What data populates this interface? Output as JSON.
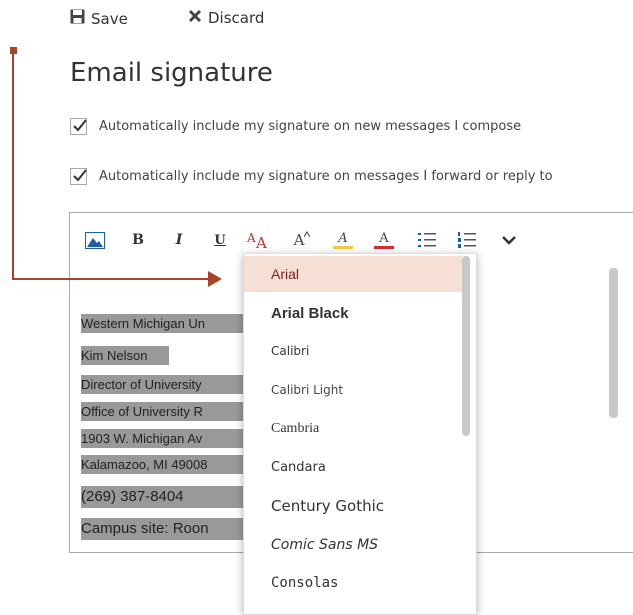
{
  "toolbar": {
    "save_label": "Save",
    "discard_label": "Discard"
  },
  "page_title": "Email signature",
  "options": {
    "new_messages": {
      "label": "Automatically include my signature on new messages I compose",
      "checked": true
    },
    "forward_reply": {
      "label": "Automatically include my signature on messages I forward or reply to",
      "checked": true
    }
  },
  "format_toolbar": {
    "bold": "B",
    "italic": "I",
    "underline": "U",
    "font_size": "A",
    "text_highlight": "A",
    "font_color": "A"
  },
  "signature": {
    "lines": [
      "Western Michigan Un",
      "Kim Nelson",
      "Director of University",
      "Office of University R",
      "1903 W. Michigan Av",
      "Kalamazoo, MI 49008",
      "(269) 387-8404",
      "Campus site: Roon"
    ]
  },
  "font_menu": {
    "selected": "Arial",
    "items": [
      "Arial",
      "Arial Black",
      "Calibri",
      "Calibri Light",
      "Cambria",
      "Candara",
      "Century Gothic",
      "Comic Sans MS",
      "Consolas"
    ]
  },
  "colors": {
    "accent_arrow": "#a8432a",
    "selected_bg": "#f6dfd4",
    "selected_text": "#7a1e1e",
    "highlight_bg": "#999999"
  }
}
